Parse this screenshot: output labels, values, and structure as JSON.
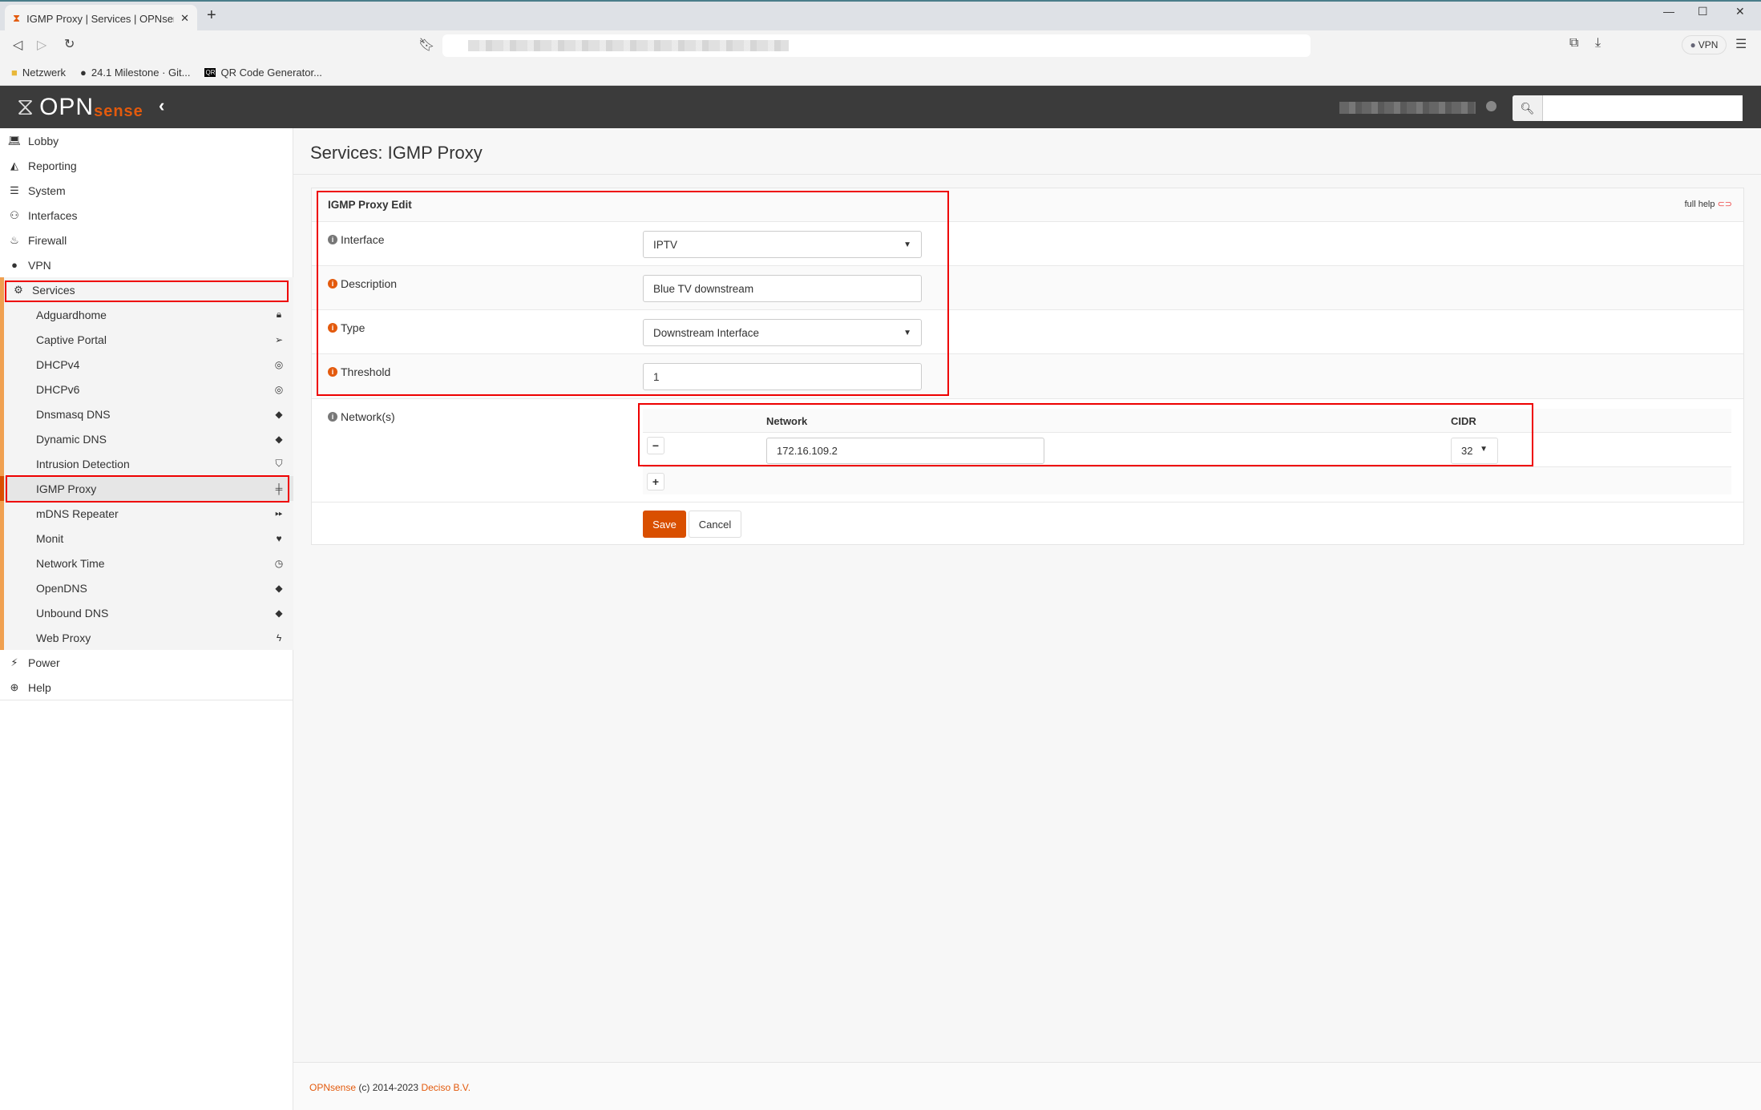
{
  "browser": {
    "tab_title": "IGMP Proxy | Services | OPNsense",
    "vpn_label": "VPN",
    "bookmarks": [
      "Netzwerk",
      "24.1 Milestone · Git...",
      "QR Code Generator..."
    ]
  },
  "header": {
    "logo_main": "OPN",
    "logo_accent": "sense",
    "search_placeholder": ""
  },
  "sidebar": {
    "items": [
      {
        "label": "Lobby",
        "icon": "laptop-icon"
      },
      {
        "label": "Reporting",
        "icon": "area-chart-icon"
      },
      {
        "label": "System",
        "icon": "server-icon"
      },
      {
        "label": "Interfaces",
        "icon": "sitemap-icon"
      },
      {
        "label": "Firewall",
        "icon": "fire-icon"
      },
      {
        "label": "VPN",
        "icon": "globe-icon"
      },
      {
        "label": "Services",
        "icon": "gear-icon"
      }
    ],
    "services": [
      {
        "label": "Adguardhome",
        "icon": "lock-icon"
      },
      {
        "label": "Captive Portal",
        "icon": "paper-plane-icon"
      },
      {
        "label": "DHCPv4",
        "icon": "bullseye-icon"
      },
      {
        "label": "DHCPv6",
        "icon": "bullseye-icon"
      },
      {
        "label": "Dnsmasq DNS",
        "icon": "tags-icon"
      },
      {
        "label": "Dynamic DNS",
        "icon": "tags-icon"
      },
      {
        "label": "Intrusion Detection",
        "icon": "shield-icon"
      },
      {
        "label": "IGMP Proxy",
        "icon": "sliders-icon"
      },
      {
        "label": "mDNS Repeater",
        "icon": "fast-forward-icon"
      },
      {
        "label": "Monit",
        "icon": "heartbeat-icon"
      },
      {
        "label": "Network Time",
        "icon": "clock-icon"
      },
      {
        "label": "OpenDNS",
        "icon": "tags-icon"
      },
      {
        "label": "Unbound DNS",
        "icon": "tags-icon"
      },
      {
        "label": "Web Proxy",
        "icon": "bolt-icon"
      }
    ],
    "bottom": [
      {
        "label": "Power",
        "icon": "plug-icon"
      },
      {
        "label": "Help",
        "icon": "life-ring-icon"
      }
    ]
  },
  "page": {
    "title": "Services: IGMP Proxy"
  },
  "form": {
    "section_title": "IGMP Proxy Edit",
    "full_help": "full help",
    "interface": {
      "label": "Interface",
      "value": "IPTV"
    },
    "description": {
      "label": "Description",
      "value": "Blue TV downstream"
    },
    "type": {
      "label": "Type",
      "value": "Downstream Interface"
    },
    "threshold": {
      "label": "Threshold",
      "value": "1"
    },
    "networks": {
      "label": "Network(s)",
      "col_network": "Network",
      "col_cidr": "CIDR",
      "rows": [
        {
          "network": "172.16.109.2",
          "cidr": "32"
        }
      ]
    },
    "save": "Save",
    "cancel": "Cancel"
  },
  "footer": {
    "brand": "OPNsense",
    "copyright": "(c) 2014-2023",
    "company": "Deciso B.V."
  },
  "colors": {
    "accent": "#e35a0d",
    "header": "#3b3b3b",
    "highlight": "#ee0000"
  }
}
